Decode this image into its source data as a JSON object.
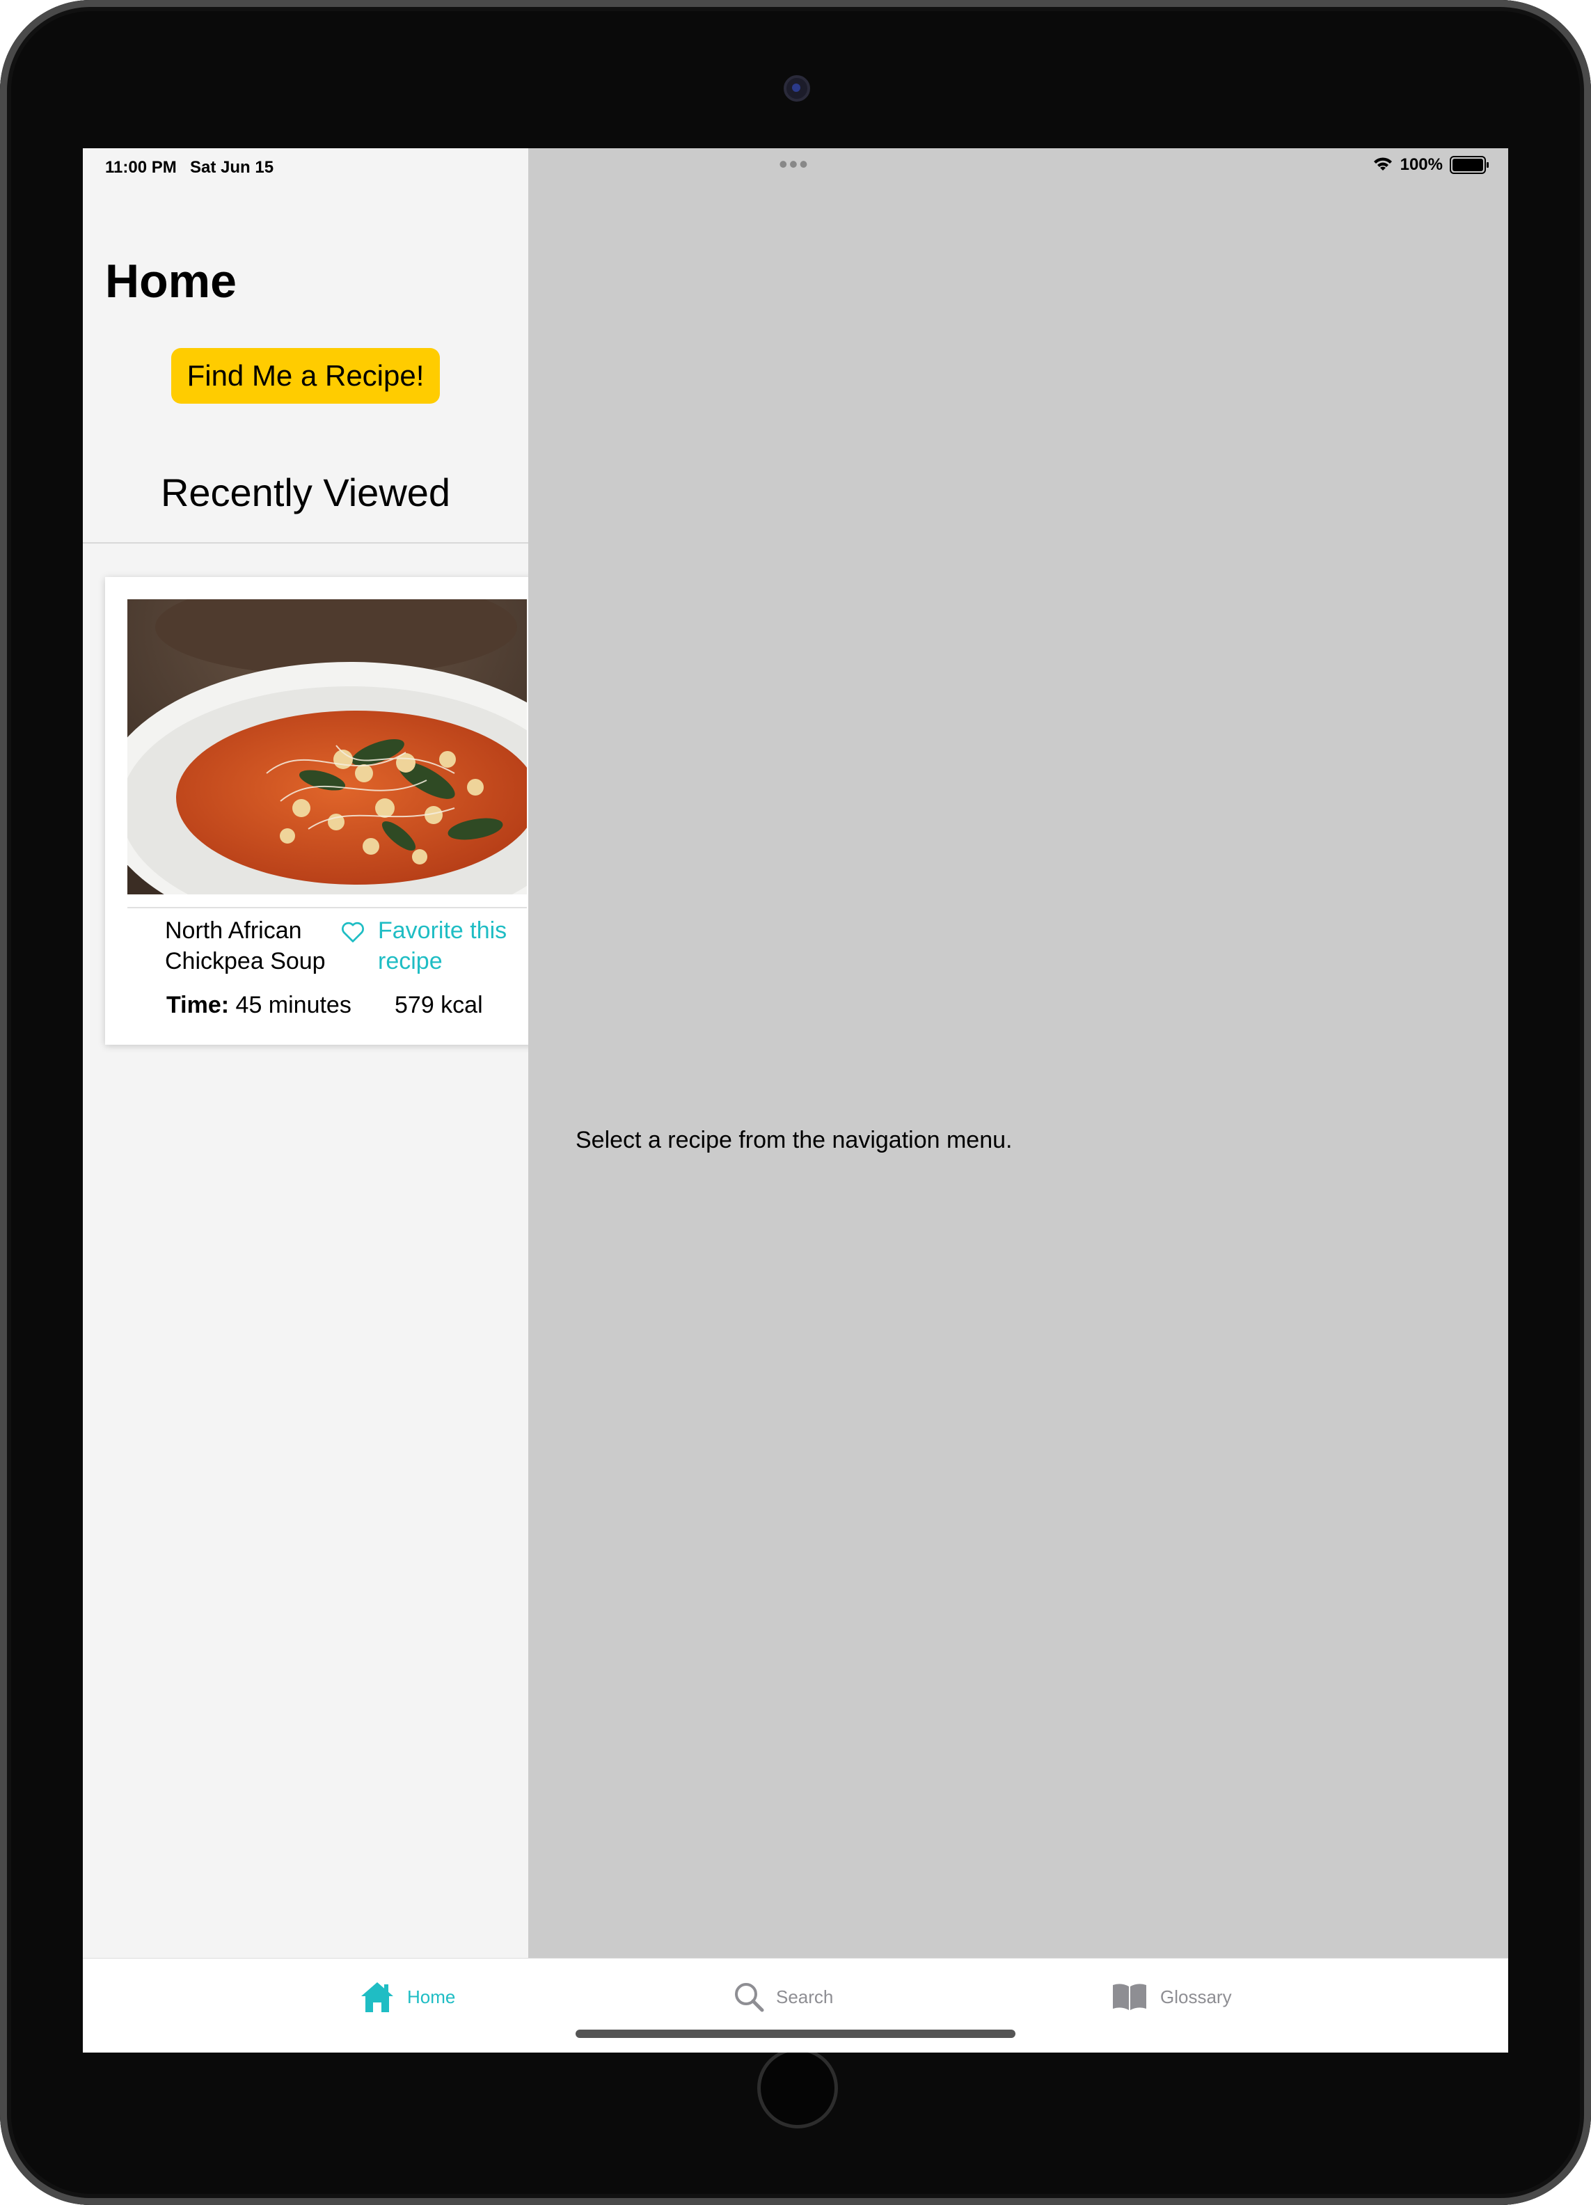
{
  "status_bar": {
    "time": "11:00 PM",
    "date": "Sat Jun 15",
    "battery": "100%"
  },
  "sidebar": {
    "title": "Home",
    "find_button": "Find Me a Recipe!",
    "section_title": "Recently Viewed",
    "recent": [
      {
        "name": "North African Chickpea Soup",
        "favorite_label": "Favorite this recipe",
        "time_label": "Time:",
        "time_value": "45 minutes",
        "calories": "579 kcal",
        "image": "chickpea-soup-photo"
      }
    ]
  },
  "detail": {
    "placeholder": "Select a recipe from the navigation menu."
  },
  "tabbar": {
    "tabs": [
      {
        "label": "Home",
        "icon": "house-icon",
        "selected": true
      },
      {
        "label": "Search",
        "icon": "magnifier-icon",
        "selected": false
      },
      {
        "label": "Glossary",
        "icon": "book-icon",
        "selected": false
      }
    ]
  },
  "colors": {
    "accent": "#1fbdc4",
    "button": "#ffcc00",
    "sidebar_bg": "#f4f4f4",
    "detail_bg": "#cbcbcb"
  }
}
